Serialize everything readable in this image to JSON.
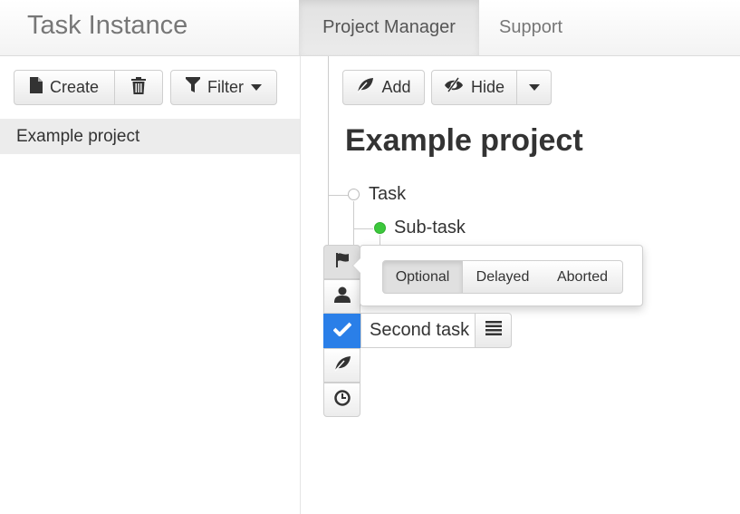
{
  "navbar": {
    "brand": "Task Instance",
    "tabs": [
      {
        "label": "Project Manager",
        "active": true
      },
      {
        "label": "Support",
        "active": false
      }
    ]
  },
  "sidebar": {
    "create_label": "Create",
    "filter_label": "Filter",
    "projects": [
      "Example project"
    ]
  },
  "main": {
    "add_label": "Add",
    "hide_label": "Hide",
    "title": "Example project",
    "tree": {
      "task": "Task",
      "subtask": "Sub-task",
      "second_task": "Second task"
    },
    "status_options": [
      "Optional",
      "Delayed",
      "Aborted"
    ],
    "selected_status": "Optional",
    "colors": {
      "subtask_dot": "#3cc83c",
      "checked_tool": "#2a7fe8"
    },
    "side_tools": [
      "flag-icon",
      "user-icon",
      "check-icon",
      "leaf-icon",
      "clock-icon"
    ]
  }
}
